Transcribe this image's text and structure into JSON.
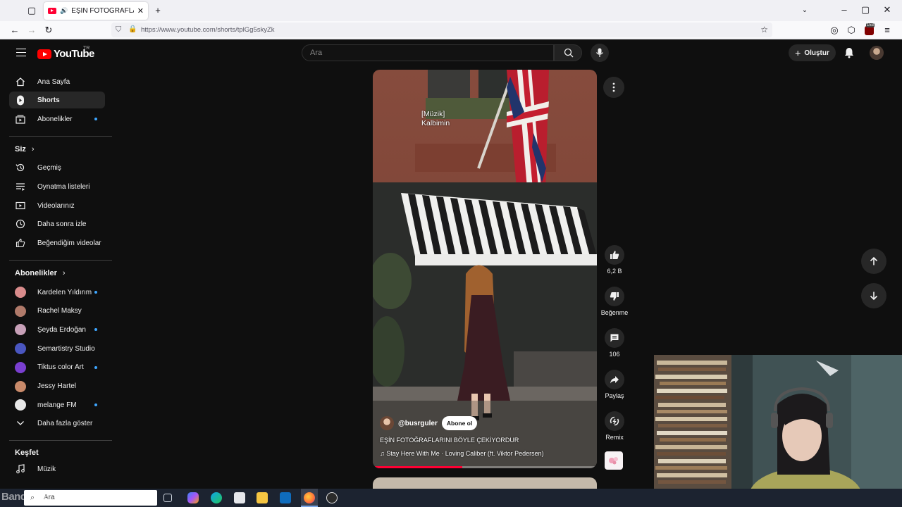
{
  "browser": {
    "tab_title": "EŞİN FOTOĞRAFLARINI BÖYLE",
    "url": "https://www.youtube.com/shorts/tplGg5skyZk",
    "badge_count": "153"
  },
  "header": {
    "logo_text": "YouTube",
    "country_code": "TR",
    "search_placeholder": "Ara",
    "create_label": "Oluştur"
  },
  "sidebar": {
    "main": [
      {
        "label": "Ana Sayfa",
        "icon": "home-icon"
      },
      {
        "label": "Shorts",
        "icon": "shorts-icon",
        "active": true
      },
      {
        "label": "Abonelikler",
        "icon": "subscriptions-icon",
        "dot": true
      }
    ],
    "you_header": "Siz",
    "you": [
      {
        "label": "Geçmiş",
        "icon": "history-icon"
      },
      {
        "label": "Oynatma listeleri",
        "icon": "playlist-icon"
      },
      {
        "label": "Videolarınız",
        "icon": "your-videos-icon"
      },
      {
        "label": "Daha sonra izle",
        "icon": "clock-icon"
      },
      {
        "label": "Beğendiğim videolar",
        "icon": "thumbs-up-icon"
      }
    ],
    "subs_header": "Abonelikler",
    "subscriptions": [
      {
        "label": "Kardelen Yıldırım",
        "dot": true,
        "color": "#d98c8c"
      },
      {
        "label": "Rachel Maksy",
        "dot": false,
        "color": "#b07a6a"
      },
      {
        "label": "Şeyda Erdoğan",
        "dot": true,
        "color": "#c7a0b8"
      },
      {
        "label": "Semartistry Studio",
        "dot": false,
        "color": "#4a56c0"
      },
      {
        "label": "Tiktus color Art",
        "dot": true,
        "color": "#7a3fd0"
      },
      {
        "label": "Jessy Hartel",
        "dot": false,
        "color": "#c98a6a"
      },
      {
        "label": "melange FM",
        "dot": true,
        "color": "#e8e8e8"
      }
    ],
    "show_more": "Daha fazla göster",
    "explore_header": "Keşfet",
    "explore": [
      {
        "label": "Müzik",
        "icon": "music-icon"
      }
    ]
  },
  "short": {
    "lyrics_line1": "[Müzik]",
    "lyrics_line2": "Kalbimin",
    "channel": "@busrguler",
    "subscribe_label": "Abone ol",
    "title": "EŞİN FOTOĞRAFLARINI BÖYLE ÇEKİYORDUR",
    "song": "Stay Here With Me · Loving Caliber (ft. Viktor Pedersen)",
    "progress": 0.4
  },
  "actions": {
    "like_count": "6,2 B",
    "dislike_label": "Beğenme",
    "comment_count": "106",
    "share_label": "Paylaş",
    "remix_label": "Remix"
  },
  "taskbar": {
    "search_placeholder": "Ara",
    "watermark": "Bandicam"
  }
}
